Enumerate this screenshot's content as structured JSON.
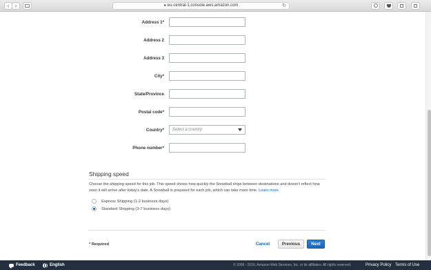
{
  "browser": {
    "url": "eu-central-1.console.aws.amazon.com",
    "back_glyph": "‹",
    "forward_glyph": "›",
    "reload_glyph": "↻"
  },
  "form": {
    "fields": [
      {
        "label": "Address 1*"
      },
      {
        "label": "Address 2"
      },
      {
        "label": "Address 3"
      },
      {
        "label": "City*"
      },
      {
        "label": "State/Province"
      },
      {
        "label": "Postal code*"
      },
      {
        "label": "Country*",
        "placeholder": "Select a country"
      },
      {
        "label": "Phone number*"
      }
    ]
  },
  "shipping": {
    "title": "Shipping speed",
    "description": "Choose the shipping speed for this job. This speed shows how quickly the Snowball ships between destinations and doesn't reflect how soon it will arrive after today's date. A Snowball is prepared for each job, which can take more time.",
    "learn_more": "Learn more.",
    "options": [
      {
        "label": "Express Shipping (1-2 business days)",
        "selected": false
      },
      {
        "label": "Standard Shipping (3-7 business days)",
        "selected": true
      }
    ]
  },
  "actions": {
    "required_note": "* Required",
    "cancel": "Cancel",
    "previous": "Previous",
    "next": "Next"
  },
  "footer": {
    "feedback": "Feedback",
    "language": "English",
    "copyright": "© 2008 - 2016, Amazon Web Services, Inc. or its affiliates. All rights reserved.",
    "privacy": "Privacy Policy",
    "terms": "Terms of Use"
  },
  "colors": {
    "accent": "#0066c0",
    "primary_button": "#1b66be",
    "footer_bg": "#232f3e"
  }
}
